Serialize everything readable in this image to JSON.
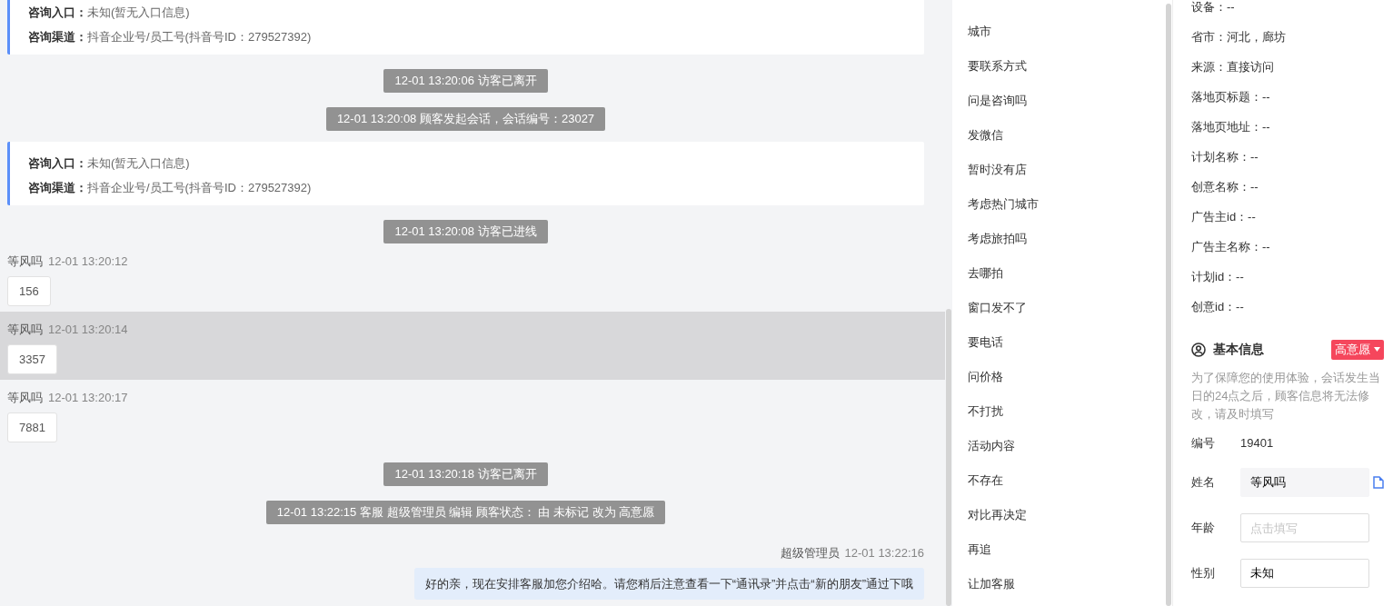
{
  "chat": {
    "messages": [
      {
        "kind": "info-card",
        "lines": [
          {
            "label": "咨询入口：",
            "value": "未知(暂无入口信息)"
          },
          {
            "label": "咨询渠道：",
            "value": "抖音企业号/员工号(抖音号ID：279527392)"
          }
        ]
      },
      {
        "kind": "system",
        "text": "12-01 13:20:06 访客已离开"
      },
      {
        "kind": "system",
        "text": "12-01 13:20:08 顾客发起会话，会话编号：23027"
      },
      {
        "kind": "info-card",
        "lines": [
          {
            "label": "咨询入口：",
            "value": "未知(暂无入口信息)"
          },
          {
            "label": "咨询渠道：",
            "value": "抖音企业号/员工号(抖音号ID：279527392)"
          }
        ]
      },
      {
        "kind": "system",
        "text": "12-01 13:20:08 访客已进线"
      },
      {
        "kind": "visitor",
        "sender": "等风吗",
        "time": "12-01 13:20:12",
        "text": "156",
        "highlighted": false
      },
      {
        "kind": "visitor",
        "sender": "等风吗",
        "time": "12-01 13:20:14",
        "text": "3357",
        "highlighted": true
      },
      {
        "kind": "visitor",
        "sender": "等风吗",
        "time": "12-01 13:20:17",
        "text": "7881",
        "highlighted": false
      },
      {
        "kind": "system",
        "text": "12-01 13:20:18 访客已离开"
      },
      {
        "kind": "system",
        "text": "12-01 13:22:15 客服 超级管理员 编辑 顾客状态： 由 未标记 改为 高意愿"
      },
      {
        "kind": "agent",
        "sender": "超级管理员",
        "time": "12-01 13:22:16",
        "text": "好的亲，现在安排客服加您介绍哈。请您稍后注意查看一下“通讯录”并点击“新的朋友”通过下哦"
      }
    ]
  },
  "quick_replies": [
    "城市",
    "要联系方式",
    "问是咨询吗",
    "发微信",
    "暂时没有店",
    "考虑热门城市",
    "考虑旅拍吗",
    "去哪拍",
    "窗口发不了",
    "要电话",
    "问价格",
    "不打扰",
    "活动内容",
    "不存在",
    "对比再决定",
    "再追",
    "让加客服"
  ],
  "visitor_info": [
    "设备：--",
    "省市：河北，廊坊",
    "来源：直接访问",
    "落地页标题：--",
    "落地页地址：--",
    "计划名称：--",
    "创意名称：--",
    "广告主id：--",
    "广告主名称：--",
    "计划id：--",
    "创意id：--"
  ],
  "basic_info": {
    "title": "基本信息",
    "status_tag": "高意愿",
    "notice": "为了保障您的使用体验，会话发生当日的24点之后，顾客信息将无法修改，请及时填写",
    "fields": [
      {
        "kind": "text",
        "label": "编号",
        "value": "19401"
      },
      {
        "kind": "readonly",
        "label": "姓名",
        "value": "等风吗"
      },
      {
        "kind": "input",
        "label": "年龄",
        "placeholder": "点击填写"
      },
      {
        "kind": "input",
        "label": "性别",
        "value": "未知"
      }
    ]
  }
}
